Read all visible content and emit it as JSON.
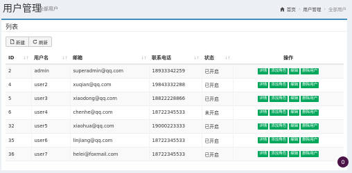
{
  "header": {
    "title": "用户管理",
    "subtitle": "全部用户",
    "breadcrumb": [
      "首页",
      "用户管理",
      "全部用户"
    ]
  },
  "panel": {
    "title": "列表",
    "new_label": "新建",
    "refresh_label": "刷新"
  },
  "table": {
    "columns": [
      "ID",
      "用户名",
      "邮箱",
      "联系电话",
      "状态",
      "操作"
    ],
    "actions": [
      "详情",
      "添加角色",
      "编辑",
      "删除用户"
    ],
    "rows": [
      {
        "id": "2",
        "username": "admin",
        "email": "superadmin@qq.com",
        "phone": "18933342259",
        "status": "已开启"
      },
      {
        "id": "4",
        "username": "user2",
        "email": "xuqian@qq.com",
        "phone": "19843332288",
        "status": "已开启"
      },
      {
        "id": "5",
        "username": "user3",
        "email": "xiaodong@qq.com",
        "phone": "18822228866",
        "status": "已开启"
      },
      {
        "id": "6",
        "username": "user4",
        "email": "chenhe@qq.com",
        "phone": "18722345533",
        "status": "未开启"
      },
      {
        "id": "32",
        "username": "user5",
        "email": "xiaohua@qq.com",
        "phone": "19000223333",
        "status": "已开启"
      },
      {
        "id": "35",
        "username": "user6",
        "email": "linjiang@qq.com",
        "phone": "18722345533",
        "status": "已开启"
      },
      {
        "id": "36",
        "username": "user7",
        "email": "helei@foxmail.com",
        "phone": "18722345533",
        "status": "已开启"
      }
    ]
  },
  "fab_label": "0",
  "colors": {
    "accent": "#3c8dbc",
    "action": "#00a65a",
    "fab": "#4b1248"
  }
}
